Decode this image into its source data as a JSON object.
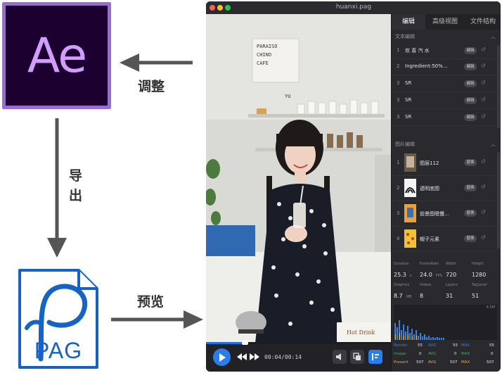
{
  "diagram": {
    "ae_logo_text": "Ae",
    "pag_label": "PAG",
    "label_adjust": "调整",
    "label_export": "导出",
    "label_preview": "预览"
  },
  "window": {
    "title": "huanxi.pag"
  },
  "tabs": [
    {
      "label": "编辑",
      "active": true
    },
    {
      "label": "高级视图",
      "active": false
    },
    {
      "label": "文件结构",
      "active": false
    }
  ],
  "text_section": {
    "title": "文本编辑",
    "items": [
      {
        "index": "1",
        "name": "欢 喜 汽 水",
        "edit": "编辑"
      },
      {
        "index": "2",
        "name": "Ingredient:50%…",
        "edit": "编辑"
      },
      {
        "index": "3",
        "name": "SR",
        "edit": "编辑"
      },
      {
        "index": "3",
        "name": "SR",
        "edit": "编辑"
      },
      {
        "index": "3",
        "name": "SR",
        "edit": "编辑"
      }
    ]
  },
  "image_section": {
    "title": "图片编辑",
    "items": [
      {
        "index": "1",
        "name": "图层112",
        "edit": "替换"
      },
      {
        "index": "2",
        "name": "透明底图",
        "edit": "替换"
      },
      {
        "index": "3",
        "name": "前景图嗯慢…",
        "edit": "替换"
      },
      {
        "index": "4",
        "name": "帽子元素",
        "edit": "替换"
      }
    ]
  },
  "stats": {
    "duration": {
      "label": "Duration",
      "value": "25.3",
      "unit": "s"
    },
    "framerate": {
      "label": "FrameRate",
      "value": "24.0",
      "unit": "FPS"
    },
    "width": {
      "label": "Width",
      "value": "720"
    },
    "height": {
      "label": "Height",
      "value": "1280"
    },
    "graphics": {
      "label": "Graphics",
      "value": "8.7",
      "unit": "MB"
    },
    "videos": {
      "label": "Videos",
      "value": "8"
    },
    "layers": {
      "label": "Layers",
      "value": "31"
    },
    "taglevel": {
      "label": "TagLevel",
      "value": "51"
    }
  },
  "perf": {
    "corner_label": "4.5M",
    "rows": [
      {
        "label": "Render",
        "cur": "55",
        "avg_label": "AVG",
        "avg": "55",
        "max_label": "MAX",
        "max": "55"
      },
      {
        "label": "Image",
        "cur": "0",
        "avg_label": "AVG",
        "avg": "0",
        "max_label": "MAX",
        "max": "0"
      },
      {
        "label": "Present",
        "cur": "507",
        "avg_label": "AVG",
        "avg": "507",
        "max_label": "MAX",
        "max": "507"
      }
    ]
  },
  "player": {
    "time": "00:04/00:14",
    "progress": 0.2
  },
  "colors": {
    "accent": "#2a7dec",
    "render": "#3b7fe0",
    "image": "#37b06a",
    "present": "#e0b23a"
  }
}
